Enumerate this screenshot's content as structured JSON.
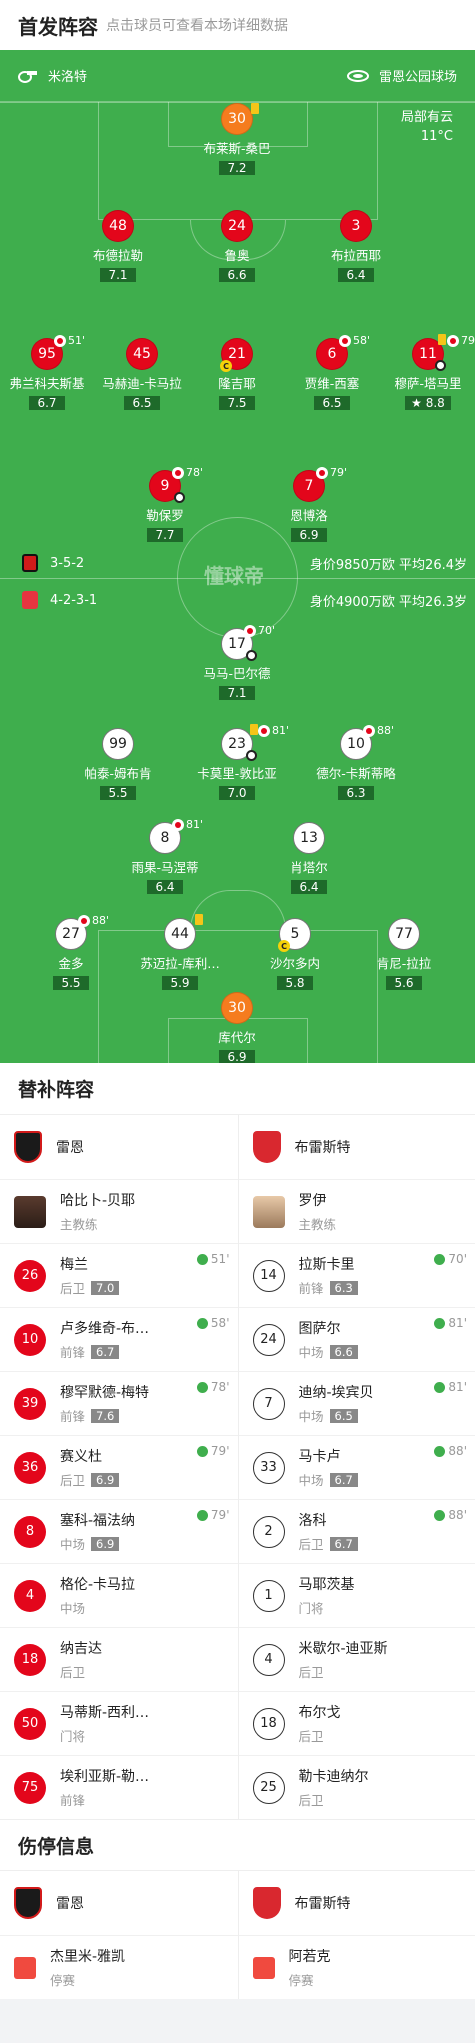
{
  "header": {
    "title": "首发阵容",
    "subtitle": "点击球员可查看本场详细数据"
  },
  "venue": {
    "referee_icon": "whistle-icon",
    "referee": "米洛特",
    "stadium_icon": "stadium-icon",
    "stadium": "雷恩公园球场"
  },
  "weather": {
    "condition": "局部有云",
    "temp": "11°C"
  },
  "watermark": "懂球帝",
  "home_team": {
    "name": "雷恩",
    "formation": "3-5-2",
    "value_text": "身价9850万欧 平均26.4岁",
    "color": "#e3061b",
    "players": [
      {
        "no": "30",
        "name": "布莱斯-桑巴",
        "rating": "7.2",
        "gk": true
      },
      {
        "no": "48",
        "name": "布德拉勒",
        "rating": "7.1"
      },
      {
        "no": "24",
        "name": "鲁奥",
        "rating": "6.6"
      },
      {
        "no": "3",
        "name": "布拉西耶",
        "rating": "6.4"
      },
      {
        "no": "95",
        "name": "弗兰科夫斯基",
        "rating": "6.7",
        "sub": "51'"
      },
      {
        "no": "45",
        "name": "马赫迪-卡马拉",
        "rating": "6.5"
      },
      {
        "no": "21",
        "name": "隆吉耶",
        "rating": "7.5"
      },
      {
        "no": "6",
        "name": "贾维-西塞",
        "rating": "6.5",
        "sub": "58'"
      },
      {
        "no": "11",
        "name": "穆萨-塔马里",
        "rating": "8.8",
        "sub": "79"
      },
      {
        "no": "9",
        "name": "勒保罗",
        "rating": "7.7",
        "sub": "78'"
      },
      {
        "no": "7",
        "name": "恩博洛",
        "rating": "6.9",
        "sub": "79'"
      }
    ]
  },
  "away_team": {
    "name": "布雷斯特",
    "formation": "4-2-3-1",
    "value_text": "身价4900万欧 平均26.3岁",
    "color": "#ffffff",
    "players": [
      {
        "no": "17",
        "name": "马马-巴尔德",
        "rating": "7.1",
        "sub": "70'"
      },
      {
        "no": "99",
        "name": "帕泰-姆布肯",
        "rating": "5.5"
      },
      {
        "no": "23",
        "name": "卡莫里-敦比亚",
        "rating": "7.0",
        "sub": "81'"
      },
      {
        "no": "10",
        "name": "德尔-卡斯蒂略",
        "rating": "6.3",
        "sub": "88'"
      },
      {
        "no": "8",
        "name": "雨果-马涅蒂",
        "rating": "6.4",
        "sub": "81'"
      },
      {
        "no": "13",
        "name": "肖塔尔",
        "rating": "6.4"
      },
      {
        "no": "27",
        "name": "金多",
        "rating": "5.5",
        "sub": "88'"
      },
      {
        "no": "44",
        "name": "苏迈拉-库利…",
        "rating": "5.9"
      },
      {
        "no": "5",
        "name": "沙尔多内",
        "rating": "5.8"
      },
      {
        "no": "77",
        "name": "肯尼-拉拉",
        "rating": "5.6"
      },
      {
        "no": "30",
        "name": "库代尔",
        "rating": "6.9",
        "gk": true
      }
    ]
  },
  "subs": {
    "title": "替补阵容",
    "home": {
      "team": "雷恩",
      "coach": {
        "name": "哈比卜-贝耶",
        "role": "主教练"
      },
      "players": [
        {
          "no": "26",
          "name": "梅兰",
          "pos": "后卫",
          "rating": "7.0",
          "time": "51'"
        },
        {
          "no": "10",
          "name": "卢多维奇-布…",
          "pos": "前锋",
          "rating": "6.7",
          "time": "58'"
        },
        {
          "no": "39",
          "name": "穆罕默德-梅特",
          "pos": "前锋",
          "rating": "7.6",
          "time": "78'"
        },
        {
          "no": "36",
          "name": "赛义杜",
          "pos": "后卫",
          "rating": "6.9",
          "time": "79'"
        },
        {
          "no": "8",
          "name": "塞科-福法纳",
          "pos": "中场",
          "rating": "6.9",
          "time": "79'"
        },
        {
          "no": "4",
          "name": "格伦-卡马拉",
          "pos": "中场",
          "rating": "",
          "time": ""
        },
        {
          "no": "18",
          "name": "纳吉达",
          "pos": "后卫",
          "rating": "",
          "time": ""
        },
        {
          "no": "50",
          "name": "马蒂斯-西利…",
          "pos": "门将",
          "rating": "",
          "time": ""
        },
        {
          "no": "75",
          "name": "埃利亚斯-勒…",
          "pos": "前锋",
          "rating": "",
          "time": ""
        }
      ]
    },
    "away": {
      "team": "布雷斯特",
      "coach": {
        "name": "罗伊",
        "role": "主教练"
      },
      "players": [
        {
          "no": "14",
          "name": "拉斯卡里",
          "pos": "前锋",
          "rating": "6.3",
          "time": "70'"
        },
        {
          "no": "24",
          "name": "图萨尔",
          "pos": "中场",
          "rating": "6.6",
          "time": "81'"
        },
        {
          "no": "7",
          "name": "迪纳-埃宾贝",
          "pos": "中场",
          "rating": "6.5",
          "time": "81'"
        },
        {
          "no": "33",
          "name": "马卡卢",
          "pos": "中场",
          "rating": "6.7",
          "time": "88'"
        },
        {
          "no": "2",
          "name": "洛科",
          "pos": "后卫",
          "rating": "6.7",
          "time": "88'"
        },
        {
          "no": "1",
          "name": "马耶茨基",
          "pos": "门将",
          "rating": "",
          "time": ""
        },
        {
          "no": "4",
          "name": "米歇尔-迪亚斯",
          "pos": "后卫",
          "rating": "",
          "time": ""
        },
        {
          "no": "18",
          "name": "布尔戈",
          "pos": "后卫",
          "rating": "",
          "time": ""
        },
        {
          "no": "25",
          "name": "勒卡迪纳尔",
          "pos": "后卫",
          "rating": "",
          "time": ""
        }
      ]
    }
  },
  "injuries": {
    "title": "伤停信息",
    "home": {
      "team": "雷恩",
      "player": "杰里米-雅凯",
      "status": "停赛"
    },
    "away": {
      "team": "布雷斯特",
      "player": "阿若克",
      "status": "停赛"
    }
  }
}
